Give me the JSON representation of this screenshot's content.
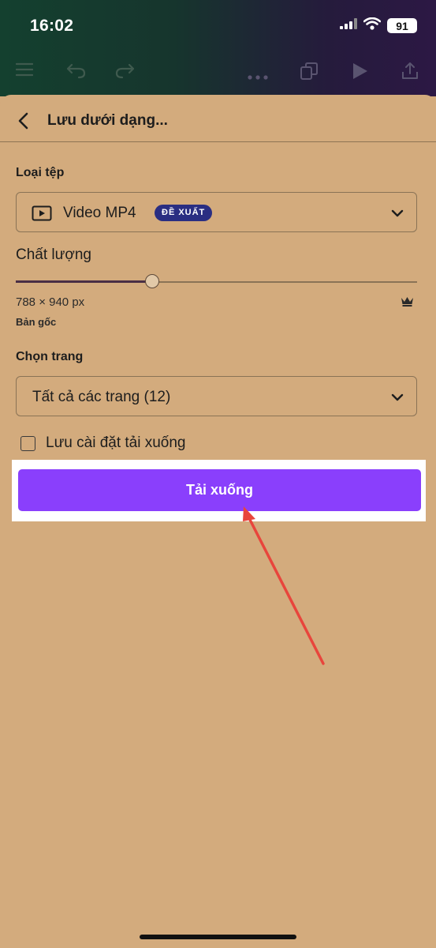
{
  "status_bar": {
    "time": "16:02",
    "battery": "91"
  },
  "toolbar": {
    "icons": [
      "menu-icon",
      "undo-icon",
      "redo-icon",
      "more-icon",
      "pages-icon",
      "play-icon",
      "share-icon"
    ]
  },
  "sheet": {
    "title": "Lưu dưới dạng...",
    "file_type": {
      "label": "Loại tệp",
      "value": "Video MP4",
      "badge": "ĐỀ XUẤT"
    },
    "quality": {
      "label": "Chất lượng",
      "level_fraction": 0.34,
      "dimensions": "788 × 940 px",
      "subtitle": "Bản gốc"
    },
    "pages": {
      "label": "Chọn trang",
      "value": "Tất cả các trang (12)"
    },
    "save_settings": {
      "label": "Lưu cài đặt tải xuống",
      "checked": false
    },
    "download_button": "Tải xuống"
  },
  "colors": {
    "accent": "#8a3ffc",
    "sheet_bg": "#d3ab7d",
    "badge_bg": "#2a2e82",
    "annotation_arrow": "#e8453c"
  }
}
